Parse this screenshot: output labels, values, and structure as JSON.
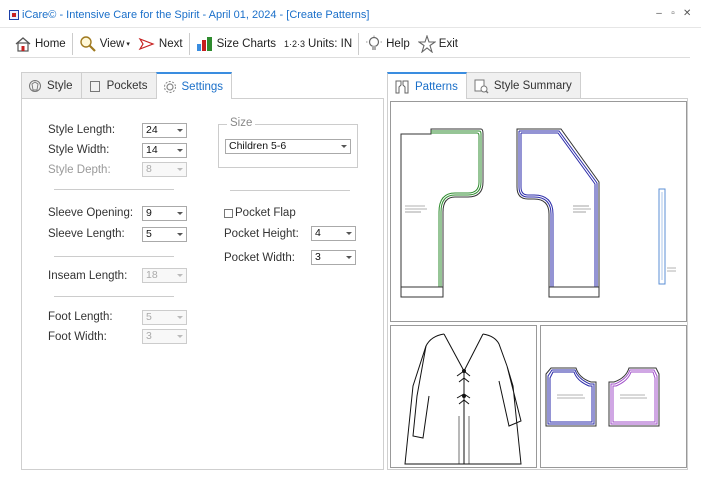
{
  "window": {
    "title": "iCare© - Intensive Care for the Spirit - April 01, 2024 - [Create Patterns]",
    "controls": [
      "–",
      "▫",
      "✕"
    ]
  },
  "toolbar": {
    "home": "Home",
    "view": "View",
    "next": "Next",
    "size_charts": "Size Charts",
    "units_prefix": "1·2·3",
    "units": "Units: IN",
    "help": "Help",
    "exit": "Exit"
  },
  "left_tabs": {
    "style": "Style",
    "pockets": "Pockets",
    "settings": "Settings"
  },
  "settings": {
    "style_length": {
      "label": "Style Length:",
      "value": "24"
    },
    "style_width": {
      "label": "Style Width:",
      "value": "14"
    },
    "style_depth": {
      "label": "Style Depth:",
      "value": "8"
    },
    "sleeve_opening": {
      "label": "Sleeve Opening:",
      "value": "9"
    },
    "sleeve_length": {
      "label": "Sleeve Length:",
      "value": "5"
    },
    "inseam_length": {
      "label": "Inseam Length:",
      "value": "18"
    },
    "foot_length": {
      "label": "Foot Length:",
      "value": "5"
    },
    "foot_width": {
      "label": "Foot Width:",
      "value": "3"
    },
    "size": {
      "legend": "Size",
      "value": "Children 5-6"
    },
    "pocket_flap": {
      "label": "Pocket Flap",
      "checked": false
    },
    "pocket_height": {
      "label": "Pocket Height:",
      "value": "4"
    },
    "pocket_width": {
      "label": "Pocket Width:",
      "value": "3"
    }
  },
  "right_tabs": {
    "patterns": "Patterns",
    "style_summary": "Style Summary"
  },
  "colors": {
    "accent": "#1a6fc9",
    "front_piece": "#2e8b2e",
    "back_piece": "#2a2aa8",
    "sleeve_piece": "#5b8fd6",
    "pocket_left": "#2a2aa8",
    "pocket_right": "#a04fc9"
  }
}
